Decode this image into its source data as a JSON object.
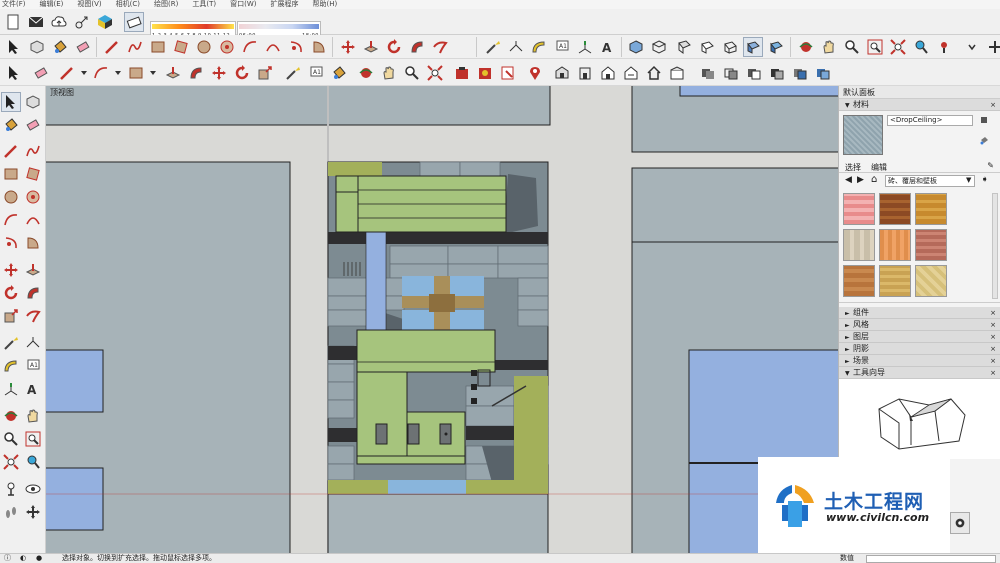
{
  "menu": [
    "文件(F)",
    "编辑(E)",
    "视图(V)",
    "相机(C)",
    "绘图(R)",
    "工具(T)",
    "窗口(W)",
    "扩展程序",
    "帮助(H)"
  ],
  "sliders": {
    "shadow_month_ticks": "1 2 3 4 5 6 7 8 9 10 11 12",
    "shadow_time_start": "06:00",
    "shadow_time_end": "18:00"
  },
  "viewport": {
    "label": "顶视图"
  },
  "panel": {
    "title": "默认面板",
    "materials": {
      "header": "材料",
      "material_name": "<DropCeiling>",
      "tab_select": "选择",
      "tab_edit": "编辑",
      "collection": "砖、覆层和壁板"
    },
    "sections": [
      "组件",
      "风格",
      "图层",
      "阴影",
      "场景"
    ],
    "instructor": "工具向导"
  },
  "status": {
    "hint": "选择对象。切换到扩充选择。拖动鼠标选择多项。",
    "measure_label": "数值"
  },
  "watermark": {
    "title": "土木工程网",
    "url": "www.civilcn.com"
  },
  "colors": {
    "ground": "#d9d9d6",
    "block": "#a7b3b8",
    "building_blue": "#94b0df",
    "roof_green": "#a6c47d",
    "water": "#89b5dc",
    "accent_red": "#c0322b"
  }
}
